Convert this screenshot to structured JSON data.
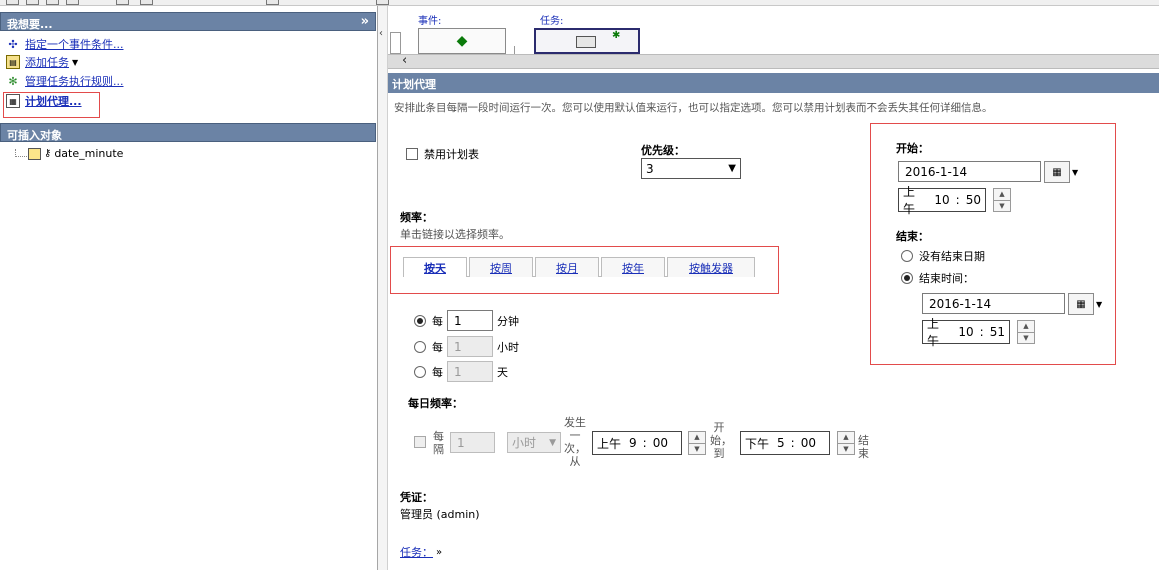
{
  "left": {
    "task_header": "我想要...",
    "tasks": [
      {
        "label": "指定一个事件条件..."
      },
      {
        "label": "添加任务"
      },
      {
        "label": "管理任务执行规则..."
      },
      {
        "label": "计划代理..."
      }
    ],
    "objects_header": "可插入对象",
    "tree_item": "date_minute"
  },
  "canvas": {
    "event_label": "事件:",
    "task_label": "任务:"
  },
  "panel": {
    "title": "计划代理",
    "description": "安排此条目每隔一段时间运行一次。您可以使用默认值来运行，也可以指定选项。您可以禁用计划表而不会丢失其任何详细信息。",
    "disable_schedule": "禁用计划表",
    "priority_label": "优先级：",
    "priority_value": "3",
    "frequency_label": "频率：",
    "frequency_hint": "单击链接以选择频率。",
    "tabs": [
      "按天",
      "按周",
      "按月",
      "按年",
      "按触发器"
    ],
    "every_label": "每",
    "rows": [
      {
        "value": "1",
        "unit": "分钟"
      },
      {
        "value": "1",
        "unit": "小时"
      },
      {
        "value": "1",
        "unit": "天"
      }
    ],
    "daily_freq_label": "每日频率：",
    "daily": {
      "every_each": "每",
      "every_interval": "隔",
      "value": "1",
      "unit": "小时",
      "occur_text": [
        "发生",
        "一",
        "次，",
        "从"
      ],
      "start_ampm": "上午",
      "start_hour": "9",
      "start_min": "00",
      "start_to": [
        "开",
        "始，",
        "到"
      ],
      "end_ampm": "下午",
      "end_hour": "5",
      "end_min": "00",
      "end_text": [
        "结",
        "束"
      ]
    },
    "credentials_label": "凭证：",
    "credentials_value": "管理员 (admin)",
    "tasks_link": "任务："
  },
  "schedule": {
    "start_label": "开始：",
    "start_date": "2016-1-14",
    "start_ampm": "上午",
    "start_hour": "10",
    "start_min": "50",
    "end_label": "结束：",
    "no_end": "没有结束日期",
    "end_time_label": "结束时间：",
    "end_date": "2016-1-14",
    "end_ampm": "上午",
    "end_hour": "10",
    "end_min": "51"
  }
}
